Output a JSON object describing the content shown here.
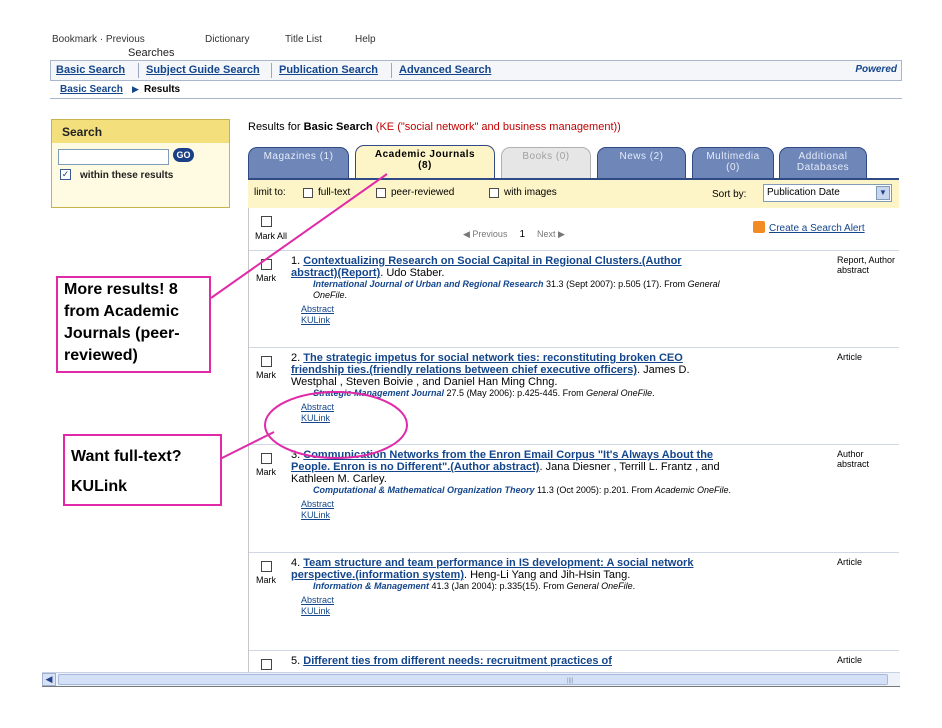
{
  "toolbar": {
    "frag_left": "Bookmark · Previous",
    "frag_mid": "Dictionary",
    "frag_right": "Title List",
    "frag_help": "Help",
    "searches_label": "Searches"
  },
  "nav": {
    "items": [
      "Basic Search",
      "Subject Guide Search",
      "Publication Search",
      "Advanced Search"
    ],
    "powered": "Powered"
  },
  "breadcrumb": {
    "link": "Basic Search",
    "arrow": "▶",
    "current": "Results"
  },
  "search_box": {
    "heading": "Search",
    "input_value": "",
    "go_label": "GO",
    "within_checked": true,
    "within_label": "within these results",
    "check_glyph": "✓"
  },
  "results_header": {
    "prefix": "Results for ",
    "type": "Basic Search",
    "query": " (KE (\"social network\" and business management))"
  },
  "tabs": [
    {
      "line1": "Magazines (1)",
      "line2": "",
      "state": "normal"
    },
    {
      "line1": "Academic Journals",
      "line2": "(8)",
      "state": "active"
    },
    {
      "line1": "Books (0)",
      "line2": "",
      "state": "disabled"
    },
    {
      "line1": "News (2)",
      "line2": "",
      "state": "normal"
    },
    {
      "line1": "Multimedia",
      "line2": "(0)",
      "state": "normal"
    },
    {
      "line1": "Additional",
      "line2": "Databases",
      "state": "normal"
    }
  ],
  "filters": {
    "limit_label": "limit to:",
    "full_text": "full-text",
    "peer_reviewed": "peer-reviewed",
    "with_images": "with images",
    "sort_label": "Sort by:",
    "sort_value": "Publication Date",
    "sort_arrow": "▼"
  },
  "toolbar_results": {
    "mark_all": "Mark All",
    "previous": "◀ Previous",
    "page": "1",
    "next": "Next ▶",
    "alert": "Create a Search Alert"
  },
  "results": [
    {
      "num": "1.",
      "title": "Contextualizing Research on Social Capital in Regional Clusters.(Author abstract)(Report)",
      "authors": ". Udo Staber.",
      "pub": "International Journal of Urban and Regional Research",
      "details": " 31.3 (Sept 2007): p.505 (17). From ",
      "db": "General OneFile",
      "db_end": ".",
      "abstract": "Abstract",
      "kulink": "KULink",
      "type": "Report, Author abstract",
      "mark": "Mark"
    },
    {
      "num": "2.",
      "title": "The strategic impetus for social network ties: reconstituting broken CEO friendship ties.(friendly relations between chief executive officers)",
      "authors": ". James D. Westphal , Steven Boivie , and Daniel Han Ming Chng.",
      "pub": "Strategic Management Journal",
      "details": " 27.5 (May 2006): p.425-445. From ",
      "db": "General OneFile",
      "db_end": ".",
      "abstract": "Abstract",
      "kulink": "KULink",
      "type": "Article",
      "mark": "Mark"
    },
    {
      "num": "3.",
      "title": "Communication Networks from the Enron Email Corpus \"It's Always About the People. Enron is no Different\".(Author abstract)",
      "authors": ". Jana Diesner , Terrill L. Frantz , and Kathleen M. Carley.",
      "pub": "Computational & Mathematical Organization Theory",
      "details": " 11.3 (Oct 2005): p.201. From ",
      "db": "Academic OneFile",
      "db_end": ".",
      "abstract": "Abstract",
      "kulink": "KULink",
      "type": "Author abstract",
      "mark": "Mark"
    },
    {
      "num": "4.",
      "title": "Team structure and team performance in IS development: A social network perspective.(information system)",
      "authors": ". Heng-Li Yang and Jih-Hsin Tang.",
      "pub": "Information & Management",
      "details": " 41.3 (Jan 2004): p.335(15). From ",
      "db": "General OneFile",
      "db_end": ".",
      "abstract": "Abstract",
      "kulink": "KULink",
      "type": "Article",
      "mark": "Mark"
    },
    {
      "num": "5.",
      "title": "Different ties from different needs: recruitment practices of",
      "authors": "",
      "pub": "",
      "details": "",
      "db": "",
      "db_end": "",
      "abstract": "",
      "kulink": "",
      "type": "Article",
      "mark": ""
    }
  ],
  "annotations": {
    "more_results": "More results! 8 from Academic Journals (peer-reviewed)",
    "full_text_line1": "Want full-text?",
    "full_text_line2": "KULink",
    "color": "#e02aa8"
  },
  "scrollbar": {
    "left_arrow": "◀",
    "grip": "||||"
  }
}
